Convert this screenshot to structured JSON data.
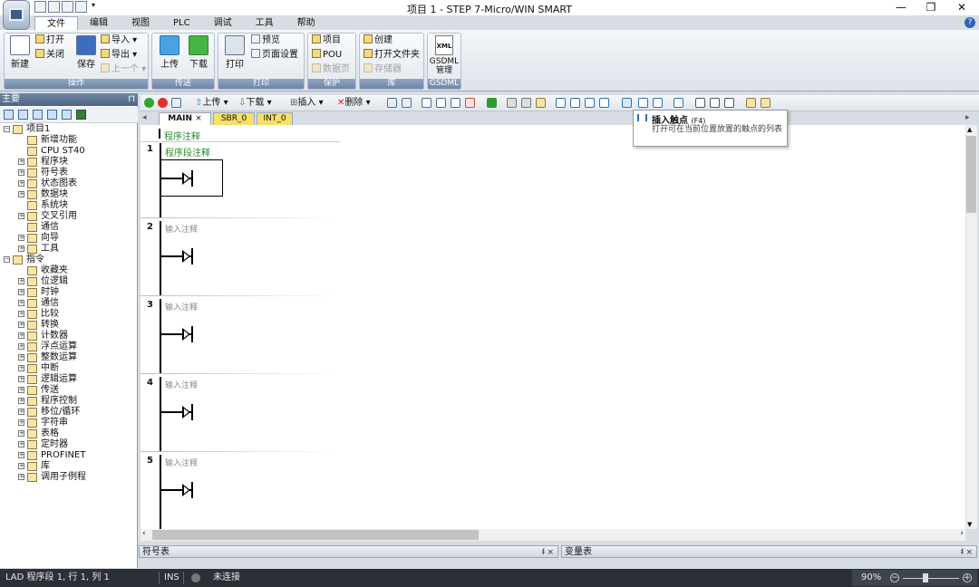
{
  "window": {
    "title": "项目 1 - STEP 7-Micro/WIN SMART",
    "controls": {
      "minimize": "—",
      "restore": "❐",
      "close": "✕"
    }
  },
  "menu_tabs": [
    "文件",
    "编辑",
    "视图",
    "PLC",
    "调试",
    "工具",
    "帮助"
  ],
  "help_icon": "?",
  "ribbon": {
    "operation": {
      "title": "操作",
      "new": "新建",
      "open": "打开",
      "close": "关闭",
      "save": "保存",
      "import": "导入",
      "export": "导出",
      "previous": "上一个"
    },
    "transfer": {
      "title": "传送",
      "upload": "上传",
      "download": "下载"
    },
    "print": {
      "title": "打印",
      "print": "打印",
      "preview": "预览",
      "page_setup": "页面设置"
    },
    "protect": {
      "title": "保护",
      "project": "项目",
      "pou": "POU",
      "data_page": "数据页"
    },
    "library": {
      "title": "库",
      "create": "创建",
      "open_folder": "打开文件夹",
      "storage": "存储器"
    },
    "gsdml": {
      "title": "GSDML",
      "label": "GSDML\n管理",
      "icon_text": "XML"
    }
  },
  "left_panel": {
    "title": "主要",
    "pin": "⊓",
    "tree": [
      {
        "label": "项目1",
        "level": 0,
        "exp": "−"
      },
      {
        "label": "新增功能",
        "level": 1
      },
      {
        "label": "CPU ST40",
        "level": 1
      },
      {
        "label": "程序块",
        "level": 1,
        "exp": "+"
      },
      {
        "label": "符号表",
        "level": 1,
        "exp": "+"
      },
      {
        "label": "状态图表",
        "level": 1,
        "exp": "+"
      },
      {
        "label": "数据块",
        "level": 1,
        "exp": "+"
      },
      {
        "label": "系统块",
        "level": 1
      },
      {
        "label": "交叉引用",
        "level": 1,
        "exp": "+"
      },
      {
        "label": "通信",
        "level": 1
      },
      {
        "label": "向导",
        "level": 1,
        "exp": "+"
      },
      {
        "label": "工具",
        "level": 1,
        "exp": "+"
      },
      {
        "label": "指令",
        "level": 0,
        "exp": "−"
      },
      {
        "label": "收藏夹",
        "level": 1
      },
      {
        "label": "位逻辑",
        "level": 1,
        "exp": "+"
      },
      {
        "label": "时钟",
        "level": 1,
        "exp": "+"
      },
      {
        "label": "通信",
        "level": 1,
        "exp": "+"
      },
      {
        "label": "比较",
        "level": 1,
        "exp": "+"
      },
      {
        "label": "转换",
        "level": 1,
        "exp": "+"
      },
      {
        "label": "计数器",
        "level": 1,
        "exp": "+"
      },
      {
        "label": "浮点运算",
        "level": 1,
        "exp": "+"
      },
      {
        "label": "整数运算",
        "level": 1,
        "exp": "+"
      },
      {
        "label": "中断",
        "level": 1,
        "exp": "+"
      },
      {
        "label": "逻辑运算",
        "level": 1,
        "exp": "+"
      },
      {
        "label": "传送",
        "level": 1,
        "exp": "+"
      },
      {
        "label": "程序控制",
        "level": 1,
        "exp": "+"
      },
      {
        "label": "移位/循环",
        "level": 1,
        "exp": "+"
      },
      {
        "label": "字符串",
        "level": 1,
        "exp": "+"
      },
      {
        "label": "表格",
        "level": 1,
        "exp": "+"
      },
      {
        "label": "定时器",
        "level": 1,
        "exp": "+"
      },
      {
        "label": "PROFINET",
        "level": 1,
        "exp": "+"
      },
      {
        "label": "库",
        "level": 1,
        "exp": "+"
      },
      {
        "label": "调用子例程",
        "level": 1,
        "exp": "+"
      }
    ]
  },
  "editor_toolbar": {
    "upload": "上传",
    "download": "下载",
    "insert": "插入",
    "delete": "删除"
  },
  "pou_tabs": [
    {
      "label": "MAIN",
      "active": true,
      "close": "×"
    },
    {
      "label": "SBR_0",
      "active": false
    },
    {
      "label": "INT_0",
      "active": false
    }
  ],
  "editor": {
    "program_comment": "程序注释",
    "networks": [
      {
        "num": "1",
        "comment": "程序段注释"
      },
      {
        "num": "2",
        "comment": "输入注释"
      },
      {
        "num": "3",
        "comment": "输入注释"
      },
      {
        "num": "4",
        "comment": "输入注释"
      },
      {
        "num": "5",
        "comment": "输入注释"
      }
    ]
  },
  "tooltip": {
    "title": "插入触点",
    "shortcut": "(F4)",
    "description": "打开可在当前位置放置的触点的列表"
  },
  "bottom_panes": {
    "symbol_table": "符号表",
    "variable_table": "变量表",
    "ctl": "ᵮ ×"
  },
  "status_bar": {
    "position": "LAD 程序段 1, 行 1, 列 1",
    "mode": "INS",
    "connection": "未连接",
    "zoom": "90%"
  }
}
